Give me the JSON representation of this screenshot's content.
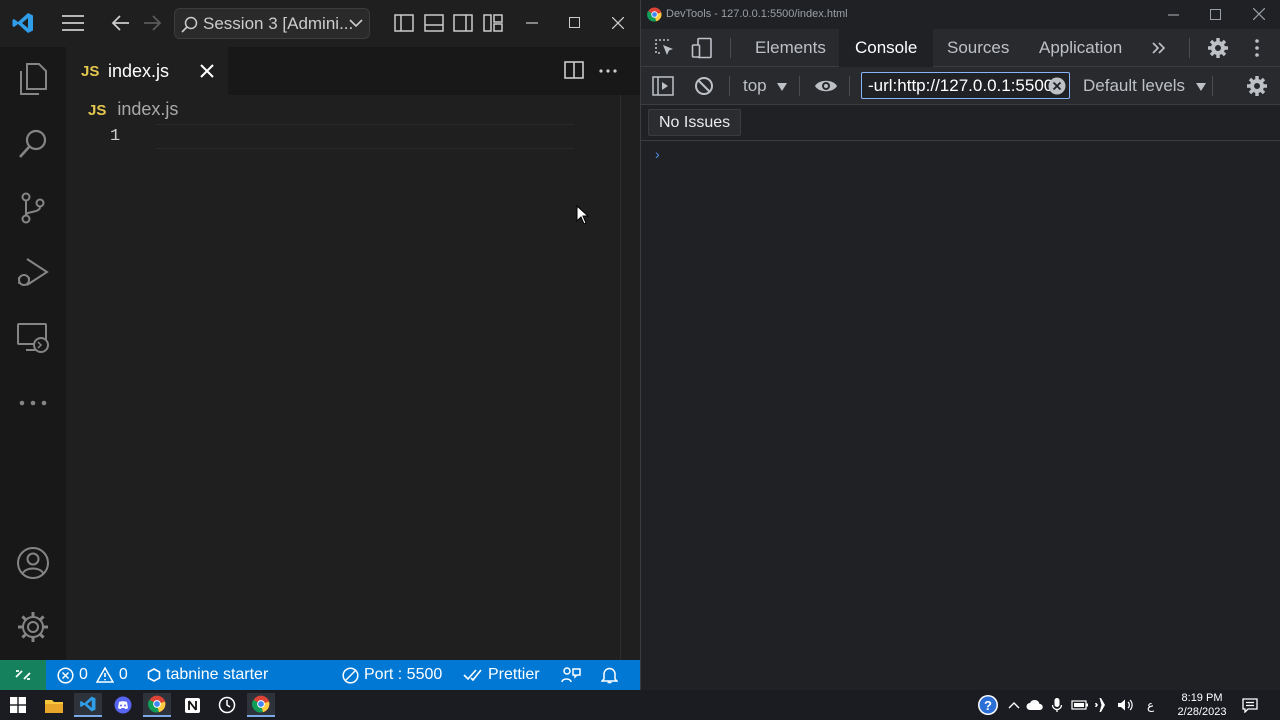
{
  "vscode": {
    "search_title": "Session 3 [Admini...",
    "tab": {
      "badge": "JS",
      "label": "index.js"
    },
    "breadcrumb": {
      "badge": "JS",
      "label": "index.js"
    },
    "editor": {
      "line_numbers": [
        "1"
      ]
    },
    "status": {
      "errors": "0",
      "warnings": "0",
      "tabnine": "tabnine starter",
      "port": "Port : 5500",
      "prettier": "Prettier"
    },
    "colors": {
      "statusbar": "#0078d4",
      "remote": "#16825d",
      "js_badge": "#e6c84f"
    }
  },
  "devtools": {
    "window_title": "DevTools - 127.0.0.1:5500/index.html",
    "tabs": [
      "Elements",
      "Console",
      "Sources",
      "Application"
    ],
    "active_tab": "Console",
    "context": "top",
    "filter_value": "-url:http://127.0.0.1:5500",
    "levels": "Default levels",
    "issues": "No Issues",
    "prompt": "›"
  },
  "taskbar": {
    "time": "8:19 PM",
    "date": "2/28/2023",
    "lang": "ع"
  }
}
